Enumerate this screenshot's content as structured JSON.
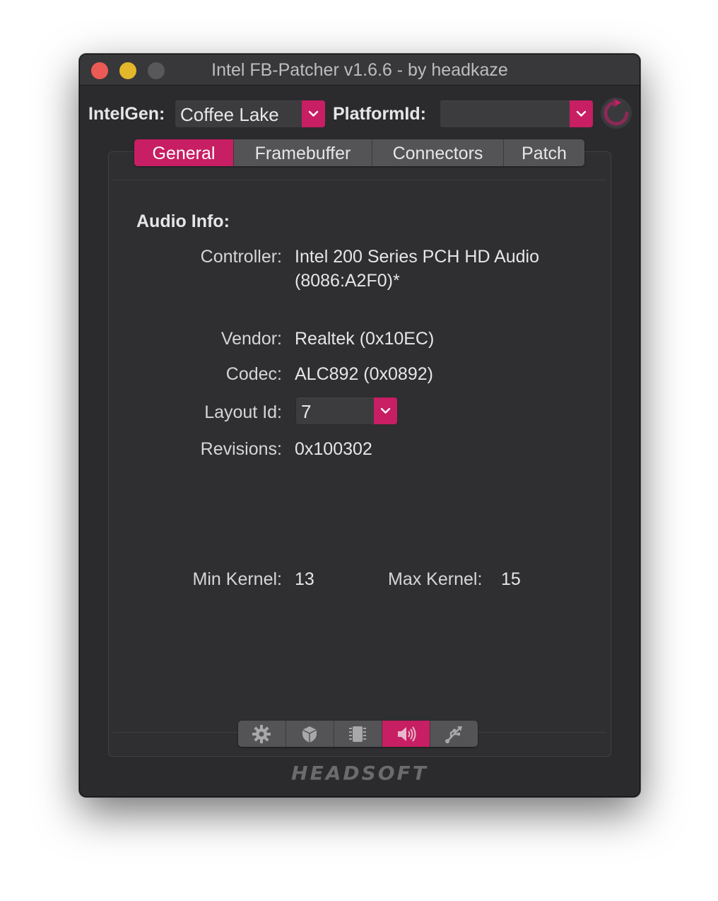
{
  "window": {
    "title": "Intel FB-Patcher v1.6.6 - by headkaze"
  },
  "toolbar": {
    "intelgen_label": "IntelGen:",
    "intelgen_value": "Coffee Lake",
    "platformid_label": "PlatformId:",
    "platformid_value": ""
  },
  "tabs": [
    {
      "label": "General",
      "active": true
    },
    {
      "label": "Framebuffer",
      "active": false
    },
    {
      "label": "Connectors",
      "active": false
    },
    {
      "label": "Patch",
      "active": false
    }
  ],
  "audio": {
    "section_title": "Audio Info:",
    "controller_label": "Controller:",
    "controller_line1": "Intel 200 Series PCH HD Audio",
    "controller_line2": "(8086:A2F0)*",
    "vendor_label": "Vendor:",
    "vendor_value": "Realtek (0x10EC)",
    "codec_label": "Codec:",
    "codec_value": "ALC892 (0x0892)",
    "layout_label": "Layout Id:",
    "layout_value": "7",
    "revisions_label": "Revisions:",
    "revisions_value": "0x100302",
    "min_kernel_label": "Min Kernel:",
    "min_kernel_value": "13",
    "max_kernel_label": "Max Kernel:",
    "max_kernel_value": "15"
  },
  "bottom_icons": [
    {
      "icon": "gear-icon",
      "active": false
    },
    {
      "icon": "gpu-icon",
      "active": false
    },
    {
      "icon": "chip-icon",
      "active": false
    },
    {
      "icon": "speaker-icon",
      "active": true
    },
    {
      "icon": "usb-icon",
      "active": false
    }
  ],
  "brand": "HEADSOFT",
  "colors": {
    "accent": "#c81e63",
    "window_bg": "#2b2b2e"
  }
}
